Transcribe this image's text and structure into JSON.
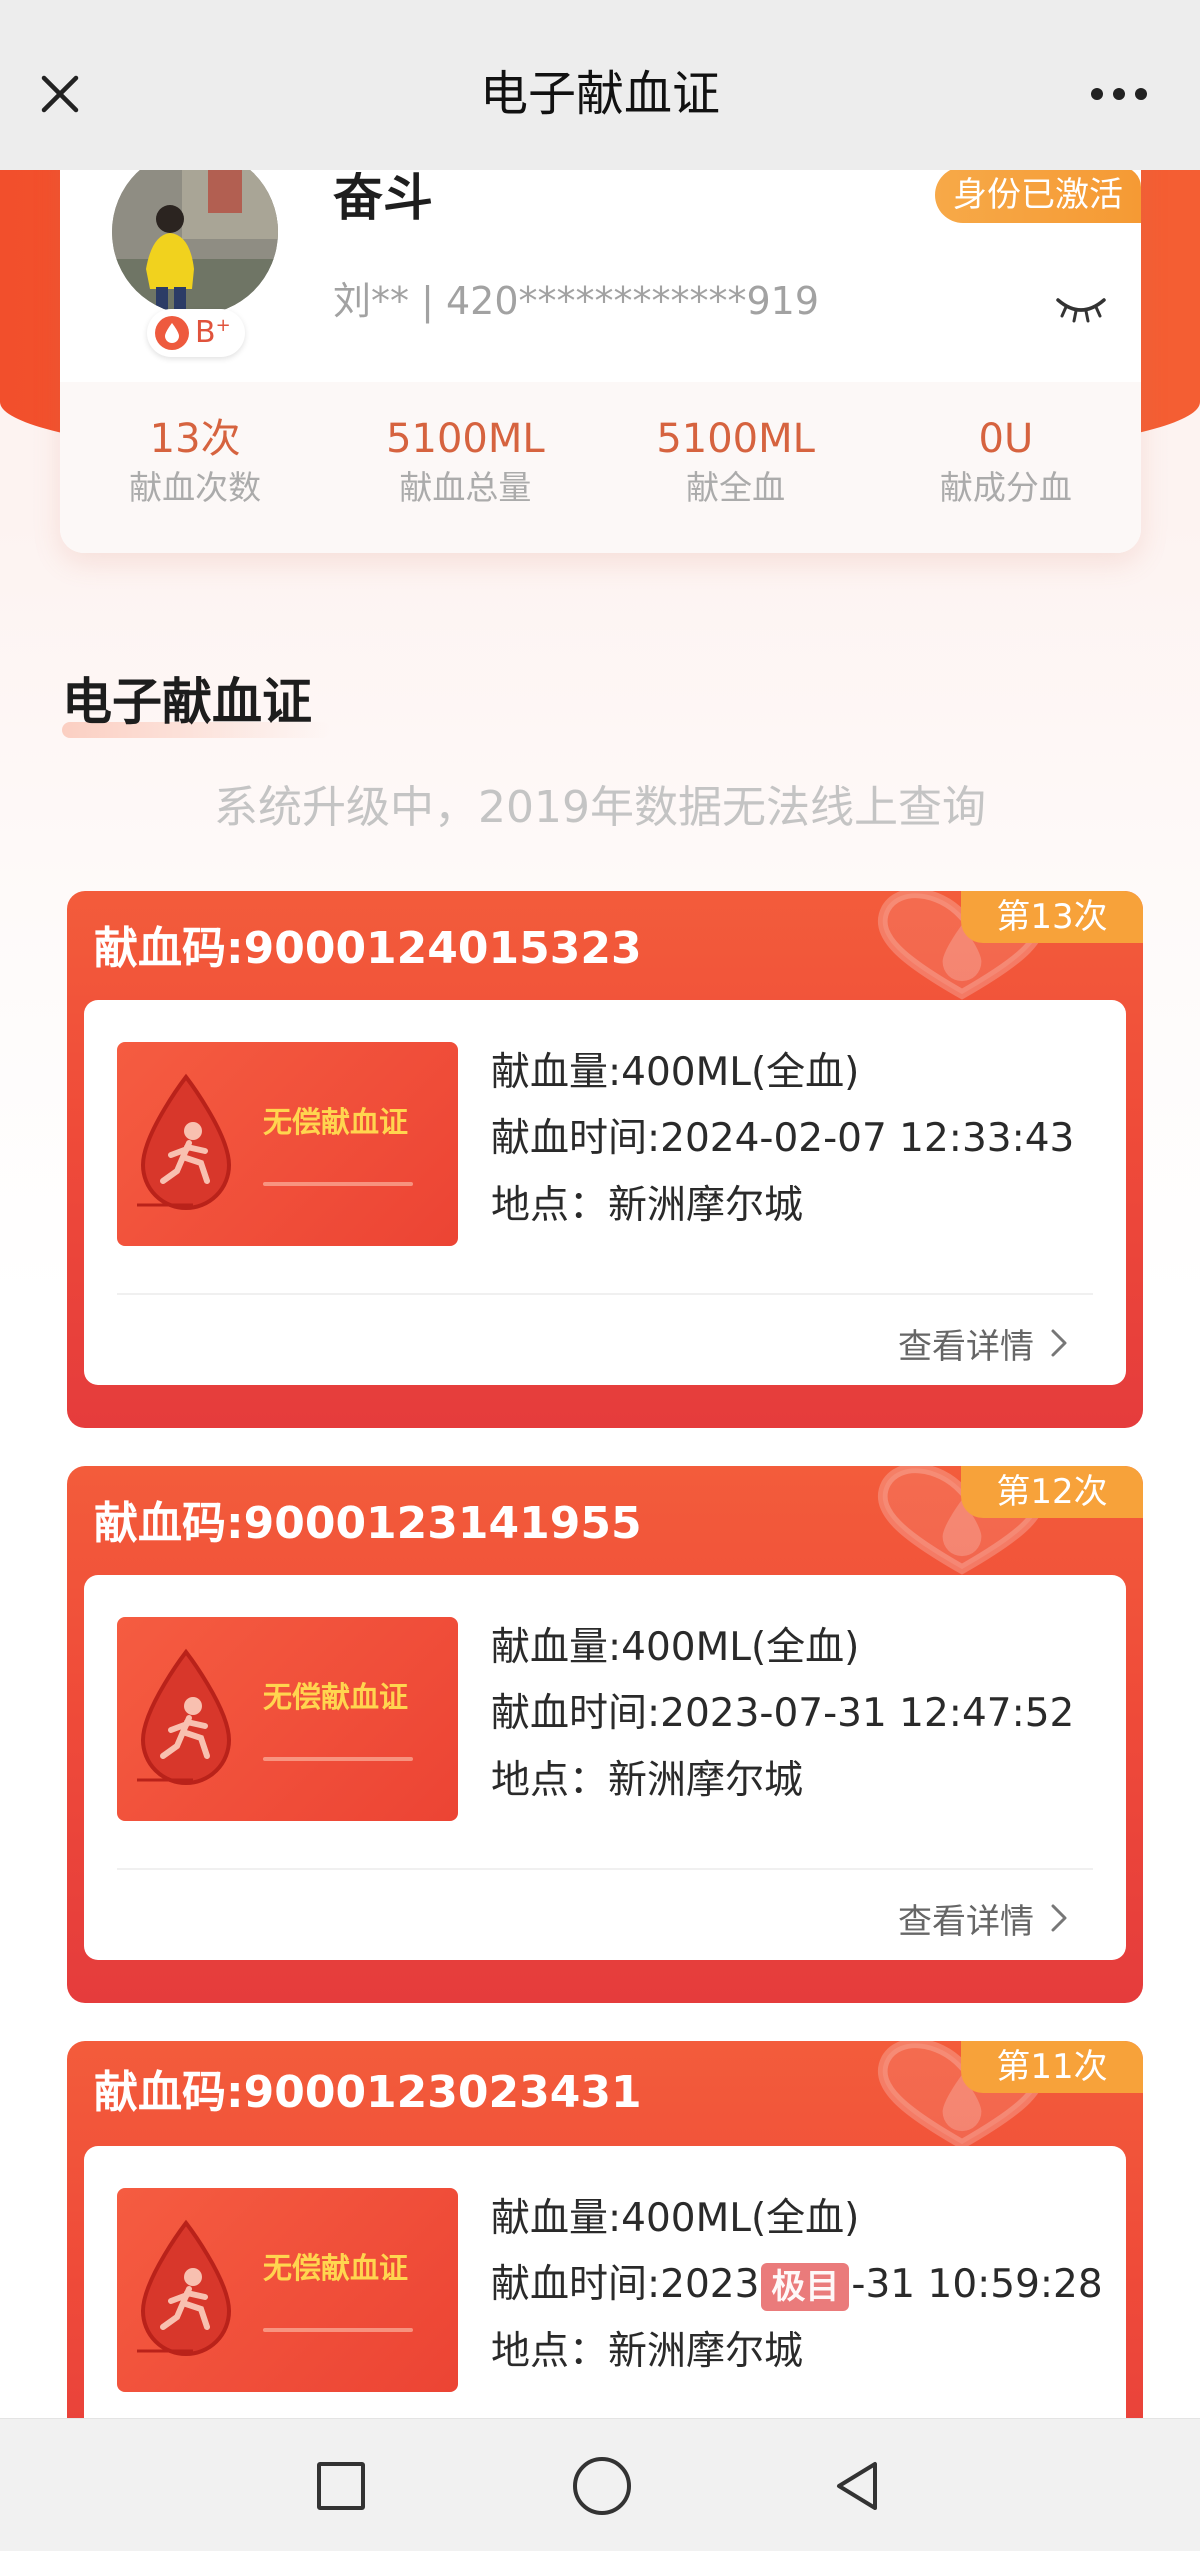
{
  "topbar": {
    "title": "电子献血证",
    "close_icon": "close-icon",
    "more_icon": "more-icon"
  },
  "profile": {
    "name": "奋斗",
    "id_info": "刘** | 420************919",
    "blood_type": {
      "group": "B",
      "rh": "+"
    },
    "status_badge": "身份已激活",
    "visibility_icon": "eye-closed-icon",
    "stats": [
      {
        "value": "13次",
        "label": "献血次数"
      },
      {
        "value": "5100ML",
        "label": "献血总量"
      },
      {
        "value": "5100ML",
        "label": "献全血"
      },
      {
        "value": "0U",
        "label": "献成分血"
      }
    ]
  },
  "section": {
    "title": "电子献血证",
    "notice": "系统升级中，2019年数据无法线上查询"
  },
  "certificate_thumbnail": {
    "title": "无偿献血证"
  },
  "records": [
    {
      "code": "献血码:9000124015323",
      "badge": "第13次",
      "amount": "献血量:400ML(全血)",
      "time": "献血时间:2024-02-07 12:33:43",
      "location": "地点：新洲摩尔城",
      "details_label": "查看详情"
    },
    {
      "code": "献血码:9000123141955",
      "badge": "第12次",
      "amount": "献血量:400ML(全血)",
      "time": "献血时间:2023-07-31 12:47:52",
      "location": "地点：新洲摩尔城",
      "details_label": "查看详情"
    },
    {
      "code": "献血码:9000123023431",
      "badge": "第11次",
      "amount": "献血量:400ML(全血)",
      "time_before": "献血时间:2023",
      "time_after": "-31 10:59:28",
      "location": "地点：新洲摩尔城"
    }
  ],
  "watermark": "极目",
  "bottom_nav": {
    "icons": [
      "recent-apps-icon",
      "home-icon",
      "back-icon"
    ]
  },
  "colors": {
    "topbar_bg": "#ededed",
    "hero_red": "#f24f2c",
    "card_red": "#ef4b39",
    "badge_orange": "#f7a23a",
    "stat_value": "#d6633f",
    "thumb_title": "#ffd54f"
  }
}
